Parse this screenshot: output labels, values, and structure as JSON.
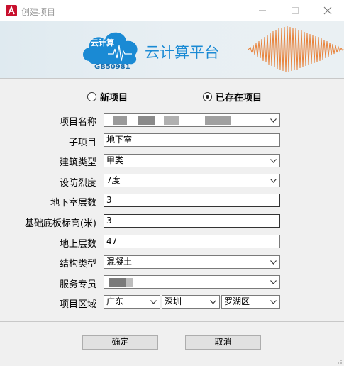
{
  "window": {
    "title": "创建项目"
  },
  "banner": {
    "logo_text": "云计算",
    "logo_code": "GB50981",
    "platform_name": "云计算平台"
  },
  "mode": {
    "new_label": "新项目",
    "existing_label": "已存在项目",
    "selected": "existing"
  },
  "form": {
    "project_name": {
      "label": "项目名称",
      "value": ""
    },
    "sub_project": {
      "label": "子项目",
      "value": "地下室"
    },
    "building_type": {
      "label": "建筑类型",
      "value": "甲类"
    },
    "intensity": {
      "label": "设防烈度",
      "value": "7度"
    },
    "basement_floors": {
      "label": "地下室层数",
      "value": "3"
    },
    "base_slab_elev": {
      "label": "基础底板标高(米)",
      "value": "3"
    },
    "above_floors": {
      "label": "地上层数",
      "value": "47"
    },
    "structure_type": {
      "label": "结构类型",
      "value": "混凝土"
    },
    "service_staff": {
      "label": "服务专员",
      "value": ""
    },
    "region": {
      "label": "项目区域",
      "province": "广东",
      "city": "深圳",
      "district": "罗湖区"
    }
  },
  "buttons": {
    "ok": "确定",
    "cancel": "取消"
  },
  "colors": {
    "accent": "#1a8ad4",
    "banner_bg": "#e3ecf1",
    "wave": "#e8823a"
  },
  "icons": {
    "app": "autocad-icon",
    "minimize": "minimize-icon",
    "maximize": "maximize-icon",
    "close": "close-icon",
    "dropdown": "chevron-down-icon"
  }
}
